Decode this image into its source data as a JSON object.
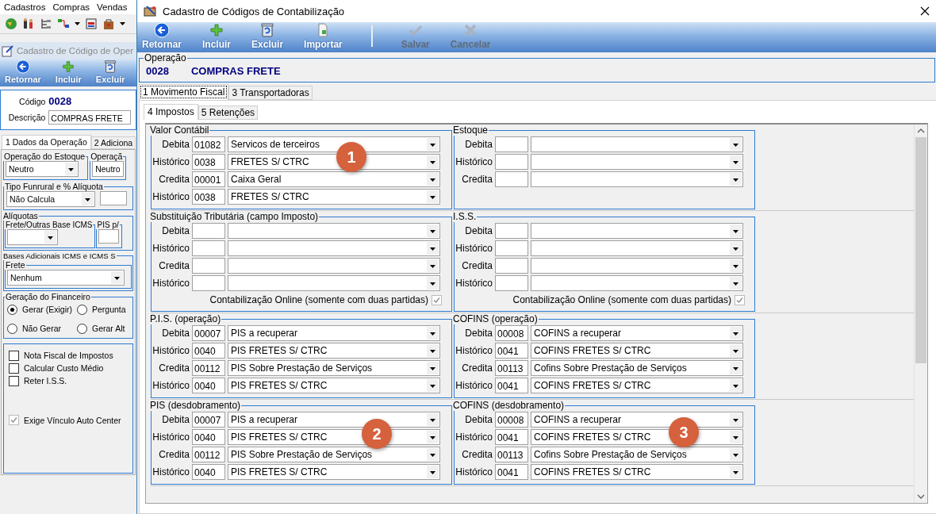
{
  "background_window": {
    "menu": [
      "Cadastros",
      "Compras",
      "Vendas"
    ],
    "title": "Cadastro de Código de Oper",
    "toolbar": [
      {
        "label": "Retornar",
        "kind": "back"
      },
      {
        "label": "Incluir",
        "kind": "plus"
      },
      {
        "label": "Excluir",
        "kind": "bin"
      }
    ],
    "code_label": "Código",
    "code": "0028",
    "description_label": "Descrição",
    "description": "COMPRAS FRETE",
    "tabs": [
      {
        "label": "1 Dados da Operação",
        "selected": true
      },
      {
        "label": "2 Adiciona",
        "selected": false
      }
    ],
    "stock_groups": [
      {
        "title": "Operação do Estoque",
        "value": "Neutro"
      },
      {
        "title": "Operaçã",
        "value": "Neutro"
      }
    ],
    "funrural": {
      "title": "Tipo Funrural e % Alíquota",
      "value": "Não Calcula"
    },
    "aliquotas": {
      "title": "Alíquotas",
      "groups": [
        {
          "title": "Frete/Outras Base ICMS"
        },
        {
          "title": "PIS p/"
        }
      ]
    },
    "bases": {
      "title": "Bases Adicionais ICMS e ICMS S",
      "frete_title": "Frete",
      "value": "Nenhum"
    },
    "financeiro": {
      "title": "Geração do Financeiro",
      "options": [
        {
          "label": "Gerar (Exigir)",
          "selected": true
        },
        {
          "label": "Pergunta",
          "selected": false
        },
        {
          "label": "Não Gerar",
          "selected": false
        },
        {
          "label": "Gerar Alt",
          "selected": false
        }
      ]
    },
    "options": [
      {
        "label": "Nota Fiscal de Impostos",
        "checked": false,
        "disabled": false
      },
      {
        "label": "Calcular Custo Médio",
        "checked": false,
        "disabled": false
      },
      {
        "label": "Reter I.S.S.",
        "checked": false,
        "disabled": false
      },
      {
        "label": "Exige Vínculo Auto Center",
        "checked": true,
        "disabled": true
      }
    ]
  },
  "dialog": {
    "title": "Cadastro de Códigos de Contabilização",
    "toolbar": [
      [
        {
          "label": "Retornar",
          "kind": "back",
          "disabled": false
        },
        {
          "label": "Incluir",
          "kind": "plus",
          "disabled": false
        },
        {
          "label": "Excluir",
          "kind": "bin",
          "disabled": false
        },
        {
          "label": "Importar",
          "kind": "import",
          "disabled": false
        }
      ],
      [
        {
          "label": "Salvar",
          "kind": "check",
          "disabled": true
        },
        {
          "label": "Cancelar",
          "kind": "cancel",
          "disabled": true
        }
      ]
    ],
    "operation": {
      "title": "Operação",
      "code": "0028",
      "name": "COMPRAS FRETE"
    },
    "tabs": [
      {
        "label": "1 Movimento Fiscal",
        "selected": true
      },
      {
        "label": "3 Transportadoras",
        "selected": false
      }
    ],
    "subtabs": [
      {
        "label": "4 Impostos",
        "selected": true
      },
      {
        "label": "5 Retenções",
        "selected": false
      }
    ],
    "section_rows": [
      [
        {
          "title": "Valor Contábil",
          "rows": [
            {
              "label": "Debita",
              "code": "01082",
              "account": "Servicos de terceiros"
            },
            {
              "label": "Histórico",
              "code": "0038",
              "account": "FRETES S/ CTRC"
            },
            {
              "label": "Credita",
              "code": "00001",
              "account": "Caixa Geral"
            },
            {
              "label": "Histórico",
              "code": "0038",
              "account": "FRETES S/ CTRC"
            }
          ]
        },
        {
          "title": "Estoque",
          "rows": [
            {
              "label": "Debita"
            },
            {
              "label": "Histórico"
            },
            {
              "label": "Credita"
            }
          ]
        }
      ],
      [
        {
          "title": "Substituição Tributária (campo Imposto)",
          "rows": [
            {
              "label": "Debita"
            },
            {
              "label": "Histórico"
            },
            {
              "label": "Credita"
            },
            {
              "label": "Histórico"
            }
          ],
          "online": {
            "label": "Contabilização Online (somente com duas partidas)",
            "checked": true
          }
        },
        {
          "title": "I.S.S.",
          "rows": [
            {
              "label": "Debita"
            },
            {
              "label": "Histórico"
            },
            {
              "label": "Credita"
            },
            {
              "label": "Histórico"
            }
          ],
          "online": {
            "label": "Contabilização Online (somente com duas partidas)",
            "checked": true
          }
        }
      ],
      [
        {
          "title": "P.I.S. (operação)",
          "rows": [
            {
              "label": "Debita",
              "code": "00007",
              "account": "PIS a recuperar"
            },
            {
              "label": "Histórico",
              "code": "0040",
              "account": "PIS FRETES S/ CTRC"
            },
            {
              "label": "Credita",
              "code": "00112",
              "account": "PIS Sobre Prestação de Serviços"
            },
            {
              "label": "Histórico",
              "code": "0040",
              "account": "PIS FRETES S/ CTRC"
            }
          ]
        },
        {
          "title": "COFINS (operação)",
          "rows": [
            {
              "label": "Debita",
              "code": "00008",
              "account": "COFINS a recuperar"
            },
            {
              "label": "Histórico",
              "code": "0041",
              "account": "COFINS FRETES S/ CTRC"
            },
            {
              "label": "Credita",
              "code": "00113",
              "account": "Cofins Sobre Prestação de Serviços"
            },
            {
              "label": "Histórico",
              "code": "0041",
              "account": "COFINS FRETES S/ CTRC"
            }
          ]
        }
      ],
      [
        {
          "title": "PIS (desdobramento)",
          "rows": [
            {
              "label": "Debita",
              "code": "00007",
              "account": "PIS a recuperar"
            },
            {
              "label": "Histórico",
              "code": "0040",
              "account": "PIS FRETES S/ CTRC"
            },
            {
              "label": "Credita",
              "code": "00112",
              "account": "PIS Sobre Prestação de Serviços"
            },
            {
              "label": "Histórico",
              "code": "0040",
              "account": "PIS FRETES S/ CTRC"
            }
          ]
        },
        {
          "title": "COFINS (desdobramento)",
          "rows": [
            {
              "label": "Debita",
              "code": "00008",
              "account": "COFINS a recuperar"
            },
            {
              "label": "Histórico",
              "code": "0041",
              "account": "COFINS FRETES S/ CTRC"
            },
            {
              "label": "Credita",
              "code": "00113",
              "account": "Cofins Sobre Prestação de Serviços"
            },
            {
              "label": "Histórico",
              "code": "0041",
              "account": "COFINS FRETES S/ CTRC"
            }
          ]
        }
      ]
    ],
    "badges": [
      "1",
      "2",
      "3"
    ]
  }
}
